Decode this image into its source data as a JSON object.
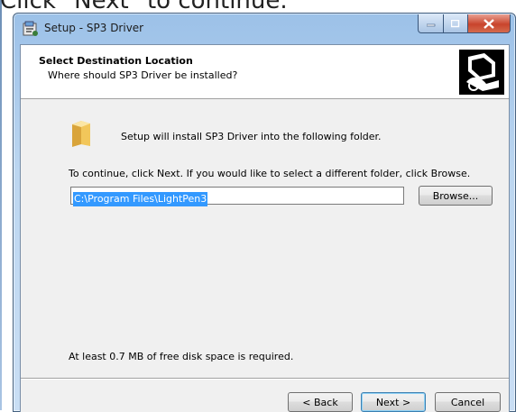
{
  "caption": "Click \"Next\" to continue.",
  "window": {
    "title": "Setup - SP3 Driver",
    "controls": {
      "minimize": "minimize",
      "maximize": "maximize",
      "close": "close"
    }
  },
  "header": {
    "title": "Select Destination Location",
    "subtitle": "Where should SP3 Driver be installed?"
  },
  "body": {
    "info_text": "Setup will install SP3 Driver into the following folder.",
    "continue_text": "To continue, click Next. If you would like to select a different folder, click Browse.",
    "path_value": "C:\\Program Files\\LightPen3",
    "browse_label": "Browse...",
    "disk_space_text": "At least 0.7 MB of free disk space is required."
  },
  "footer": {
    "back_label": "< Back",
    "next_label": "Next >",
    "cancel_label": "Cancel"
  },
  "colors": {
    "selection": "#3399ff",
    "close_button": "#c8442c",
    "dialog_bg": "#f0f0f0"
  }
}
